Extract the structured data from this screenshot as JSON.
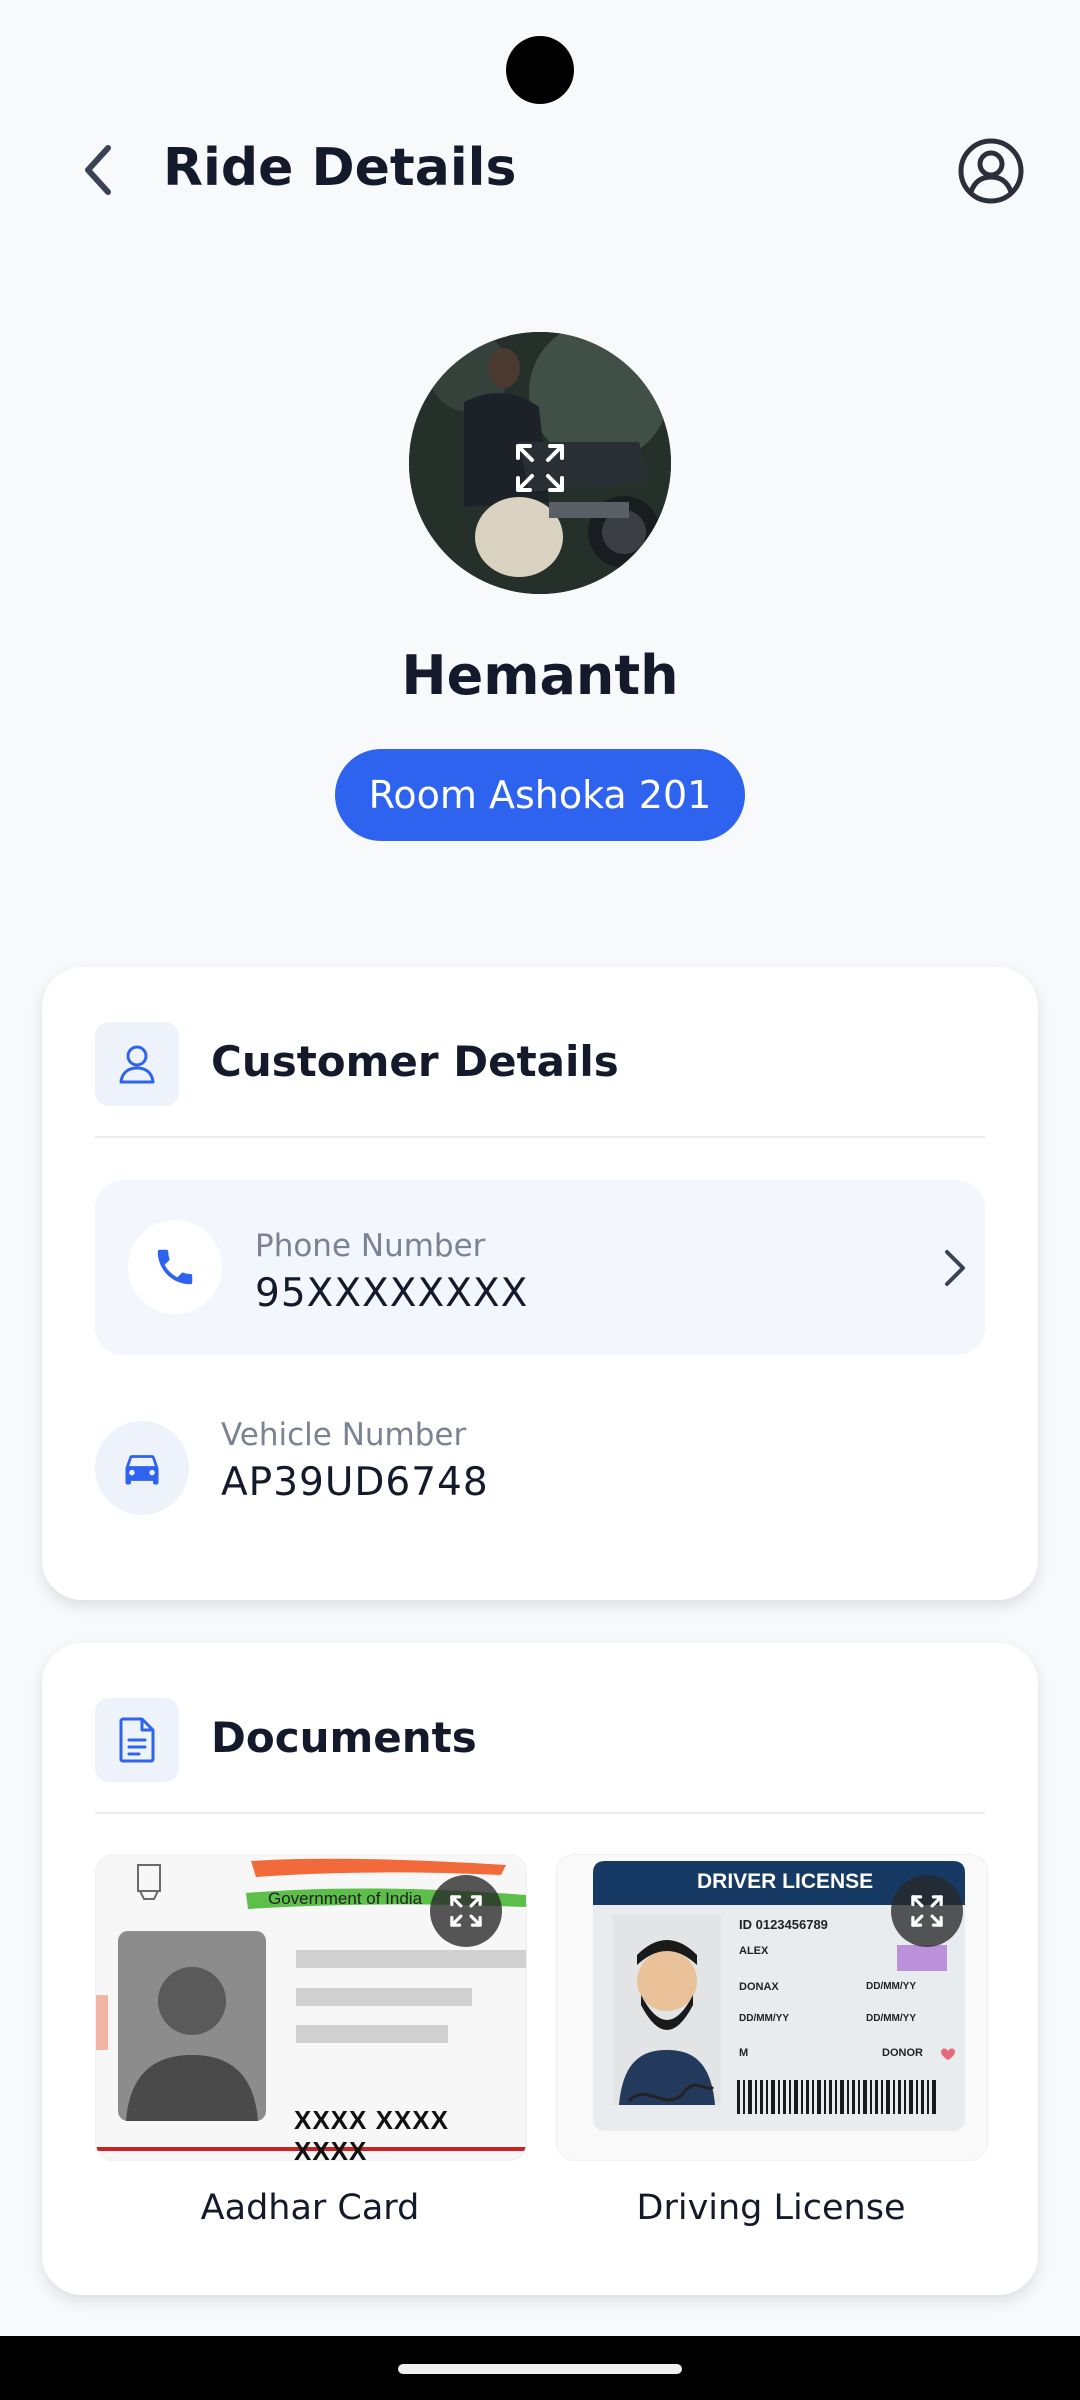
{
  "header": {
    "title": "Ride Details"
  },
  "rider": {
    "name": "Hemanth",
    "room": "Room Ashoka 201"
  },
  "customer_section": {
    "title": "Customer Details",
    "phone_label": "Phone Number",
    "phone_value": "95XXXXXXXX",
    "vehicle_label": "Vehicle Number",
    "vehicle_value": "AP39UD6748"
  },
  "documents_section": {
    "title": "Documents",
    "items": [
      {
        "caption": "Aadhar Card",
        "header_text": "Government of India",
        "number_text": "XXXX XXXX XXXX"
      },
      {
        "caption": "Driving License",
        "header_text": "DRIVER LICENSE",
        "id_text": "ID 0123456789",
        "name_text": "ALEX",
        "surname_text": "DONAX",
        "date1": "DD/MM/YY",
        "date2": "DD/MM/YY",
        "date3": "DD/MM/YY",
        "date4": "DD/MM/YY",
        "sex_text": "M",
        "donor_text": "DONOR"
      }
    ]
  },
  "colors": {
    "accent": "#2e63f0",
    "text_primary": "#141a2b",
    "text_secondary": "#7a8294",
    "icon_bg": "#eef3fb"
  }
}
